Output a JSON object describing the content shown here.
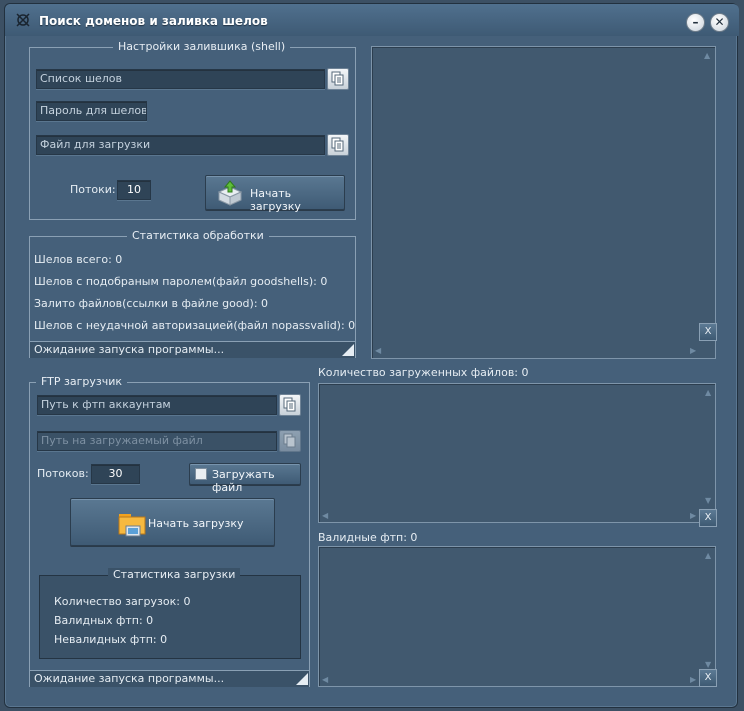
{
  "window": {
    "title": "Поиск доменов и заливка шелов",
    "minimize_label": "–",
    "close_label": "✕"
  },
  "uploader": {
    "group_title": "Настройки залившика (shell)",
    "shell_list_placeholder": "Список шелов",
    "shell_password_placeholder": "Пароль для шелов",
    "upload_file_placeholder": "Файл для загрузки",
    "threads_label": "Потоки:",
    "threads_value": "10",
    "start_label": "Начать загрузку"
  },
  "stats": {
    "group_title": "Статистика обработки",
    "lines": [
      "Шелов всего: 0",
      "Шелов с подобраным паролем(файл goodshells): 0",
      "Залито файлов(ссылки в файле good): 0",
      "Шелов с неудачной авторизацией(файл nopassvalid): 0"
    ],
    "status": "Ожидание запуска программы..."
  },
  "ftp": {
    "group_title": "FTP загрузчик",
    "accounts_placeholder": "Путь к фтп аккаунтам",
    "file_placeholder": "Путь на загружаемый файл",
    "threads_label": "Потоков:",
    "threads_value": "30",
    "upload_file_checkbox": "Загружать файл",
    "upload_file_checked": false,
    "start_label": "Начать загрузку",
    "stats_title": "Статистика загрузки",
    "stats_lines": [
      "Количество загрузок: 0",
      "Валидных фтп: 0",
      "Невалидных фтп: 0"
    ],
    "status": "Ожидание запуска программы..."
  },
  "right": {
    "clear_label": "X",
    "uploaded_files_label": "Количество загруженных файлов: 0",
    "valid_ftp_label": "Валидные фтп: 0"
  },
  "colors": {
    "window_bg": "#45607a",
    "field_bg": "#2f4457",
    "border": "#8aa0b4"
  }
}
